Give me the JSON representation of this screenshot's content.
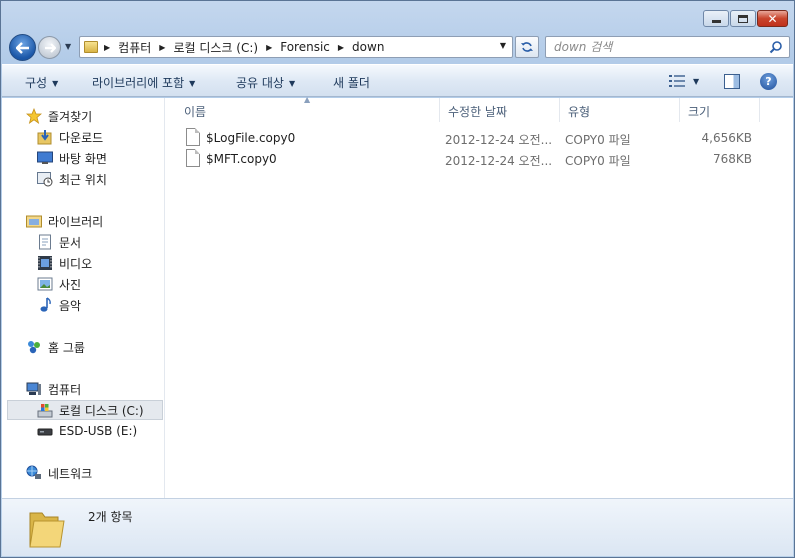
{
  "window": {
    "caption_buttons": {
      "minimize": "minimize",
      "maximize": "maximize",
      "close": "close"
    }
  },
  "address": {
    "breadcrumbs": [
      "컴퓨터",
      "로컬 디스크 (C:)",
      "Forensic",
      "down"
    ]
  },
  "search": {
    "placeholder": "down 검색"
  },
  "toolbar": {
    "organize": "구성",
    "include_in_library": "라이브러리에 포함",
    "share_with": "공유 대상",
    "new_folder": "새 폴더"
  },
  "sidebar": {
    "favorites": {
      "label": "즐겨찾기",
      "items": [
        "다운로드",
        "바탕 화면",
        "최근 위치"
      ]
    },
    "libraries": {
      "label": "라이브러리",
      "items": [
        "문서",
        "비디오",
        "사진",
        "음악"
      ]
    },
    "homegroup": {
      "label": "홈 그룹"
    },
    "computer": {
      "label": "컴퓨터",
      "items": [
        "로컬 디스크 (C:)",
        "ESD-USB (E:)"
      ]
    },
    "network": {
      "label": "네트워크"
    }
  },
  "columns": {
    "name": "이름",
    "modified": "수정한 날짜",
    "type": "유형",
    "size": "크기"
  },
  "files": [
    {
      "name": "$LogFile.copy0",
      "modified": "2012-12-24 오전...",
      "type": "COPY0 파일",
      "size": "4,656KB"
    },
    {
      "name": "$MFT.copy0",
      "modified": "2012-12-24 오전...",
      "type": "COPY0 파일",
      "size": "768KB"
    }
  ],
  "status": {
    "item_count": "2개 항목"
  },
  "colors": {
    "selected_nav": "#e5e9ee",
    "header_text": "#4c607a",
    "toolbar_text": "#1e395b"
  }
}
